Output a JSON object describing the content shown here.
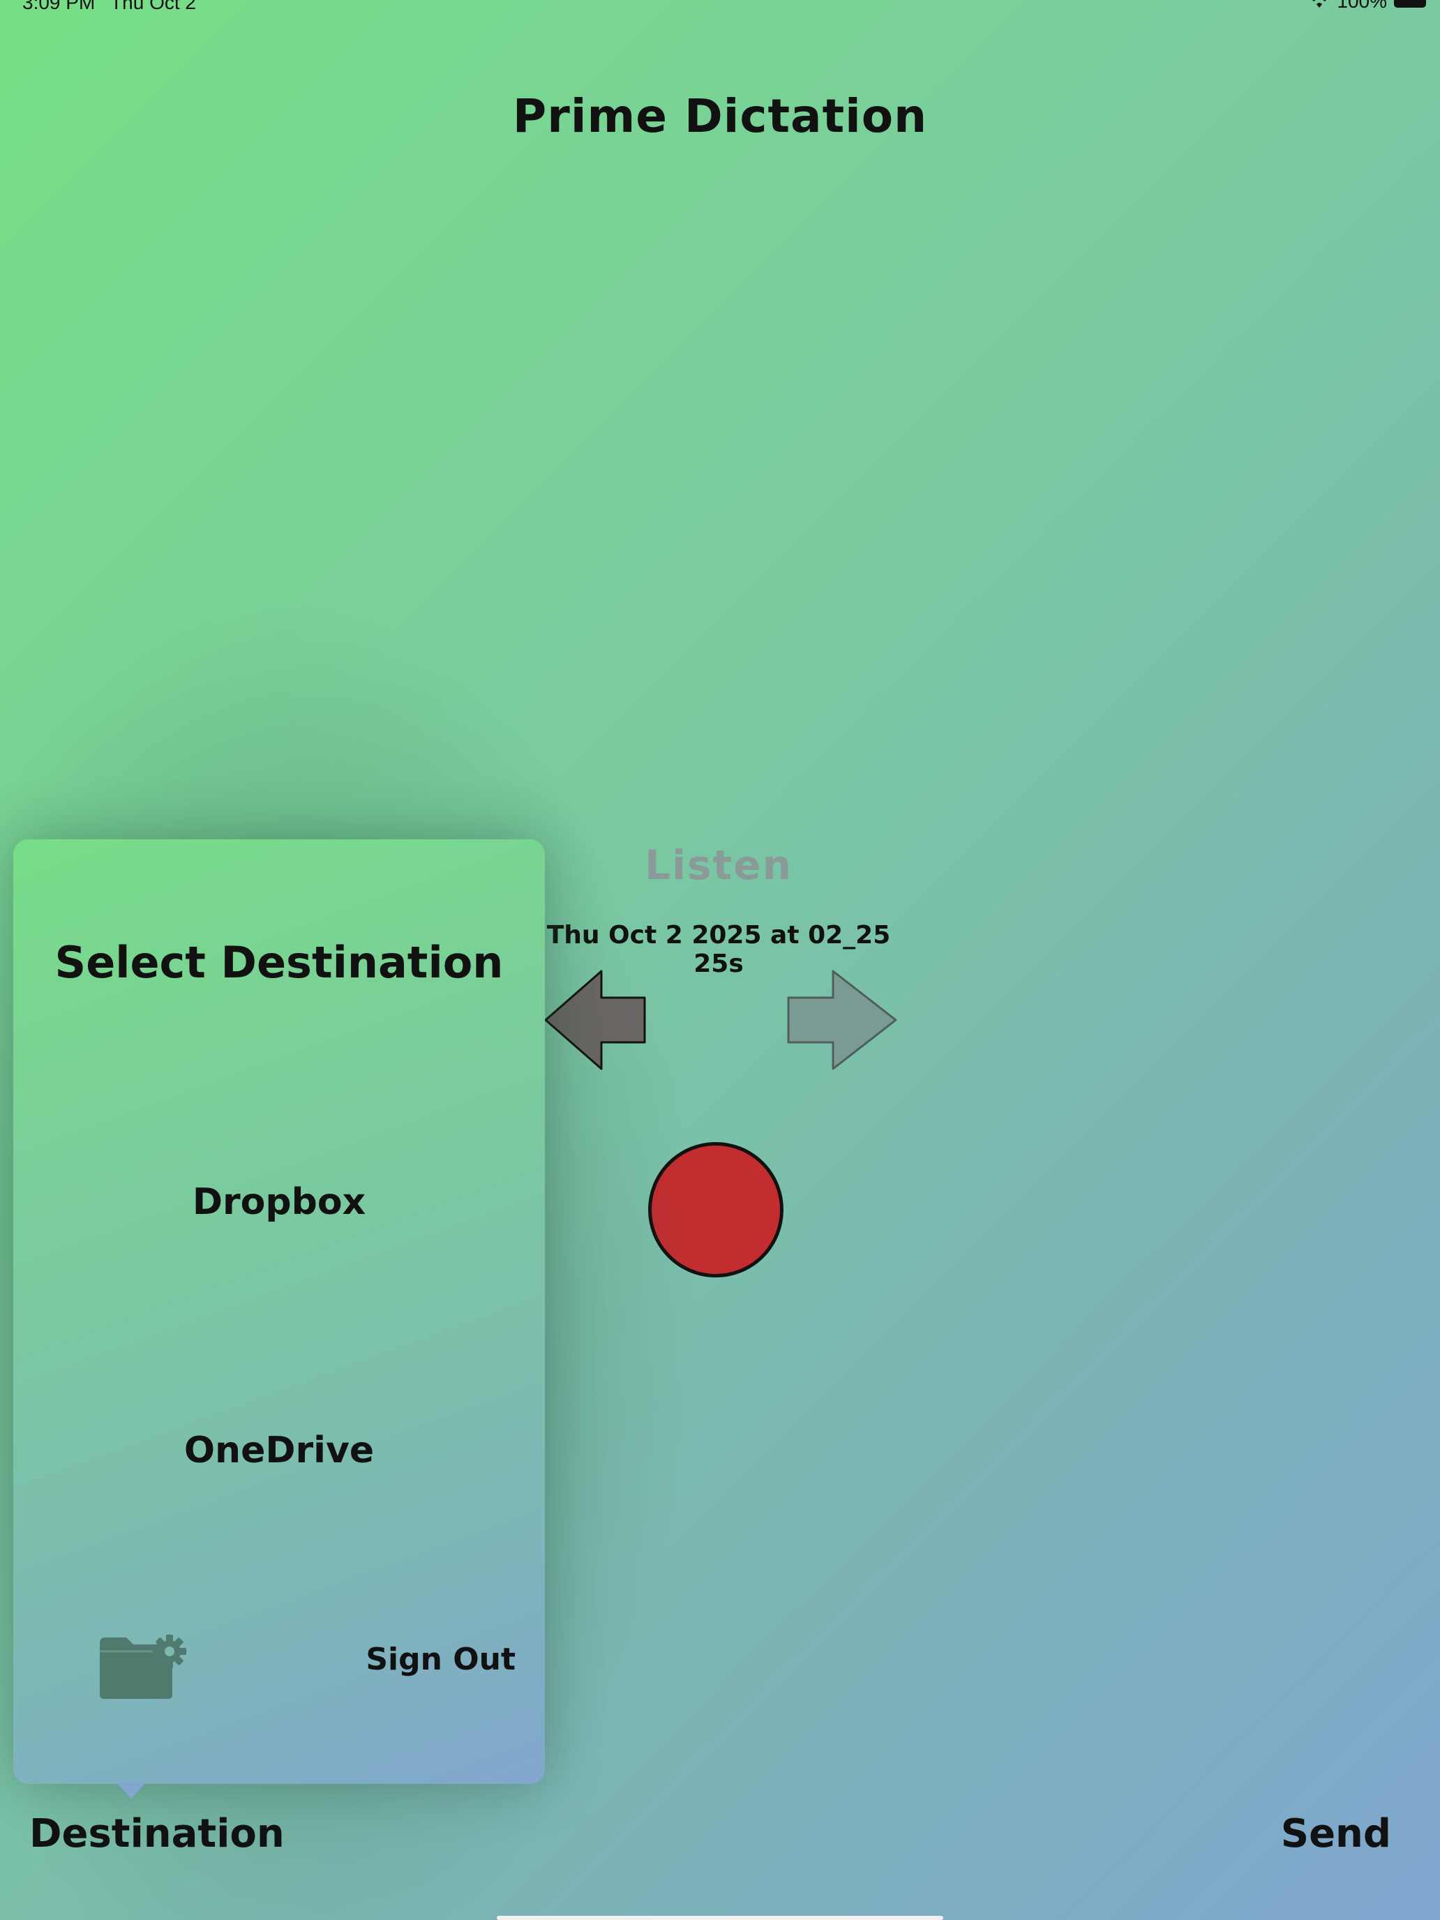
{
  "status_bar": {
    "time": "3:09 PM",
    "date": "Thu Oct 2",
    "battery_text": "100%"
  },
  "app": {
    "title": "Prime Dictation"
  },
  "main": {
    "listen_label": "Listen",
    "recording_name": "Thu Oct 2 2025 at 02_25 25s",
    "previous_arrow": "left-arrow-icon",
    "next_arrow": "right-arrow-icon",
    "record_button_icon": "record-circle"
  },
  "destination_popover": {
    "title": "Select Destination",
    "options": [
      {
        "label": "Dropbox"
      },
      {
        "label": "OneDrive"
      }
    ],
    "folder_settings_icon": "folder-gear-icon",
    "sign_out_label": "Sign Out"
  },
  "toolbar": {
    "destination_label": "Destination",
    "send_label": "Send"
  },
  "colors": {
    "record_red": "#c32d2f",
    "left_arrow": "#6c6766",
    "right_arrow": "#7a9a93",
    "listen_disabled": "#8a9a98"
  }
}
